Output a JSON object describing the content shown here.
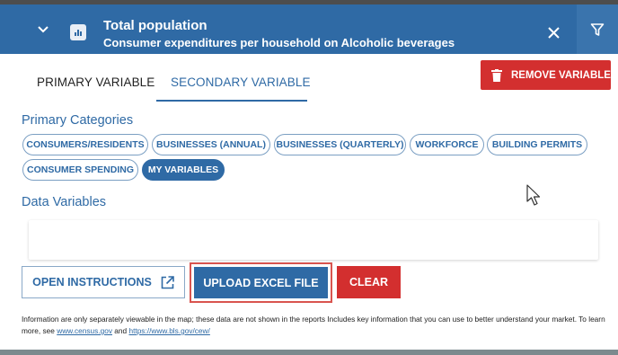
{
  "header": {
    "title": "Total population",
    "subtitle": "Consumer expenditures per household on Alcoholic beverages",
    "bg_color": "#2f6aa5"
  },
  "tabs": {
    "primary": "PRIMARY VARIABLE",
    "secondary": "SECONDARY VARIABLE",
    "active": "secondary"
  },
  "remove_button": {
    "label": "REMOVE VARIABLE",
    "color": "#d32f2f"
  },
  "primary_categories": {
    "label": "Primary Categories",
    "chips": [
      {
        "label": "CONSUMERS/RESIDENTS",
        "active": false
      },
      {
        "label": "BUSINESSES (ANNUAL)",
        "active": false
      },
      {
        "label": "BUSINESSES (QUARTERLY)",
        "active": false
      },
      {
        "label": "WORKFORCE",
        "active": false
      },
      {
        "label": "BUILDING PERMITS",
        "active": false
      },
      {
        "label": "CONSUMER SPENDING",
        "active": false
      },
      {
        "label": "MY VARIABLES",
        "active": true
      }
    ]
  },
  "data_variables": {
    "label": "Data Variables",
    "value": ""
  },
  "actions": {
    "open_instructions": "OPEN INSTRUCTIONS",
    "upload": "UPLOAD EXCEL FILE",
    "clear": "CLEAR"
  },
  "info": {
    "text_before": "Information are only separately viewable in the map; these data are not shown in the reports Includes key information that you can use to better understand your market. To learn more, see ",
    "link1": "www.census.gov",
    "middle": " and ",
    "link2": "https://www.bls.gov/cew/"
  },
  "icons": {
    "collapse": "chevron-down-icon",
    "layer": "layer-chart-icon",
    "close": "close-icon",
    "filter": "filter-icon",
    "trash": "trash-icon",
    "external": "open-external-icon",
    "cursor": "mouse-pointer-icon"
  }
}
